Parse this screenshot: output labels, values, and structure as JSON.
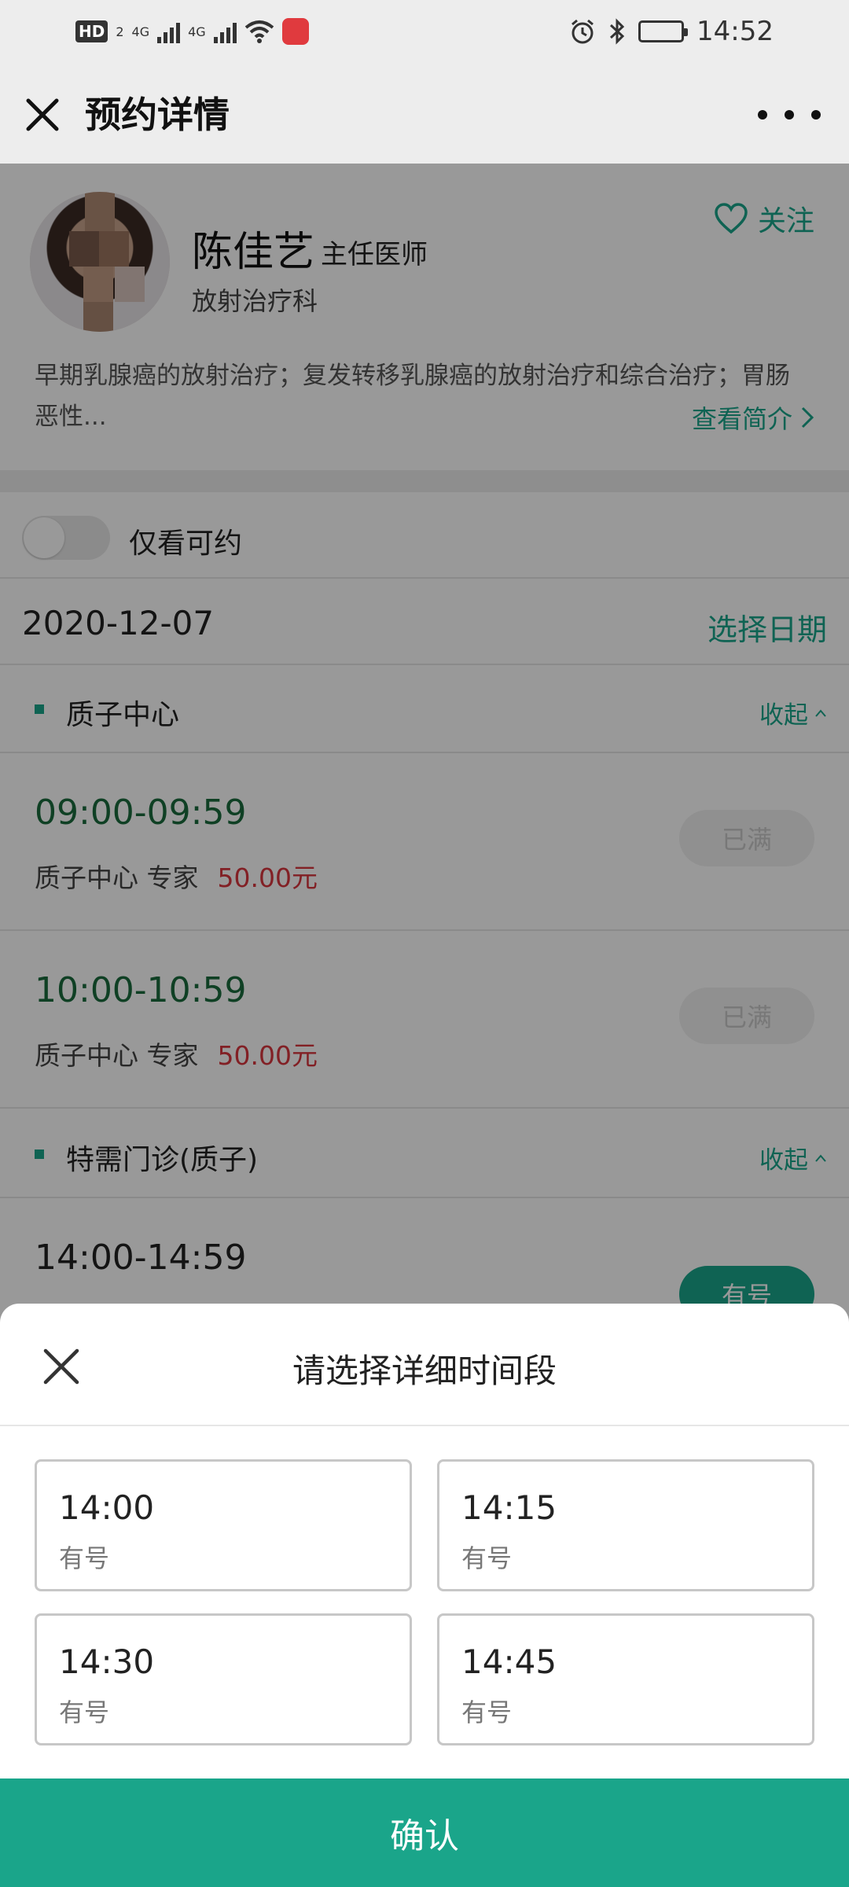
{
  "status_bar": {
    "network_badge": "HD",
    "sim_index": "2",
    "net_type_1": "4G",
    "net_type_2": "4G",
    "time": "14:52"
  },
  "navbar": {
    "title": "预约详情"
  },
  "doctor": {
    "name": "陈佳艺",
    "title": "主任医师",
    "department": "放射治疗科",
    "follow_label": "关注",
    "intro": "早期乳腺癌的放射治疗；复发转移乳腺癌的放射治疗和综合治疗；胃肠恶性...",
    "intro_more": "查看简介"
  },
  "filter": {
    "toggle_label": "仅看可约",
    "toggle_on": false
  },
  "date_row": {
    "date": "2020-12-07",
    "pick_label": "选择日期"
  },
  "sections": [
    {
      "title": "质子中心",
      "fold_label": "收起",
      "slots": [
        {
          "time": "09:00-09:59",
          "desc": "质子中心 专家",
          "price": "50.00元",
          "status": "已满"
        },
        {
          "time": "10:00-10:59",
          "desc": "质子中心 专家",
          "price": "50.00元",
          "status": "已满"
        }
      ]
    },
    {
      "title": "特需门诊(质子)",
      "fold_label": "收起",
      "slots": [
        {
          "time": "14:00-14:59",
          "status": "有号"
        }
      ]
    }
  ],
  "sheet": {
    "title": "请选择详细时间段",
    "options": [
      {
        "time": "14:00",
        "status": "有号"
      },
      {
        "time": "14:15",
        "status": "有号"
      },
      {
        "time": "14:30",
        "status": "有号"
      },
      {
        "time": "14:45",
        "status": "有号"
      }
    ],
    "confirm_label": "确认"
  },
  "colors": {
    "accent": "#1aa58a",
    "price": "#d9363e",
    "slot_time": "#1a6b3c",
    "overlay": "rgba(0,0,0,0.40)"
  }
}
